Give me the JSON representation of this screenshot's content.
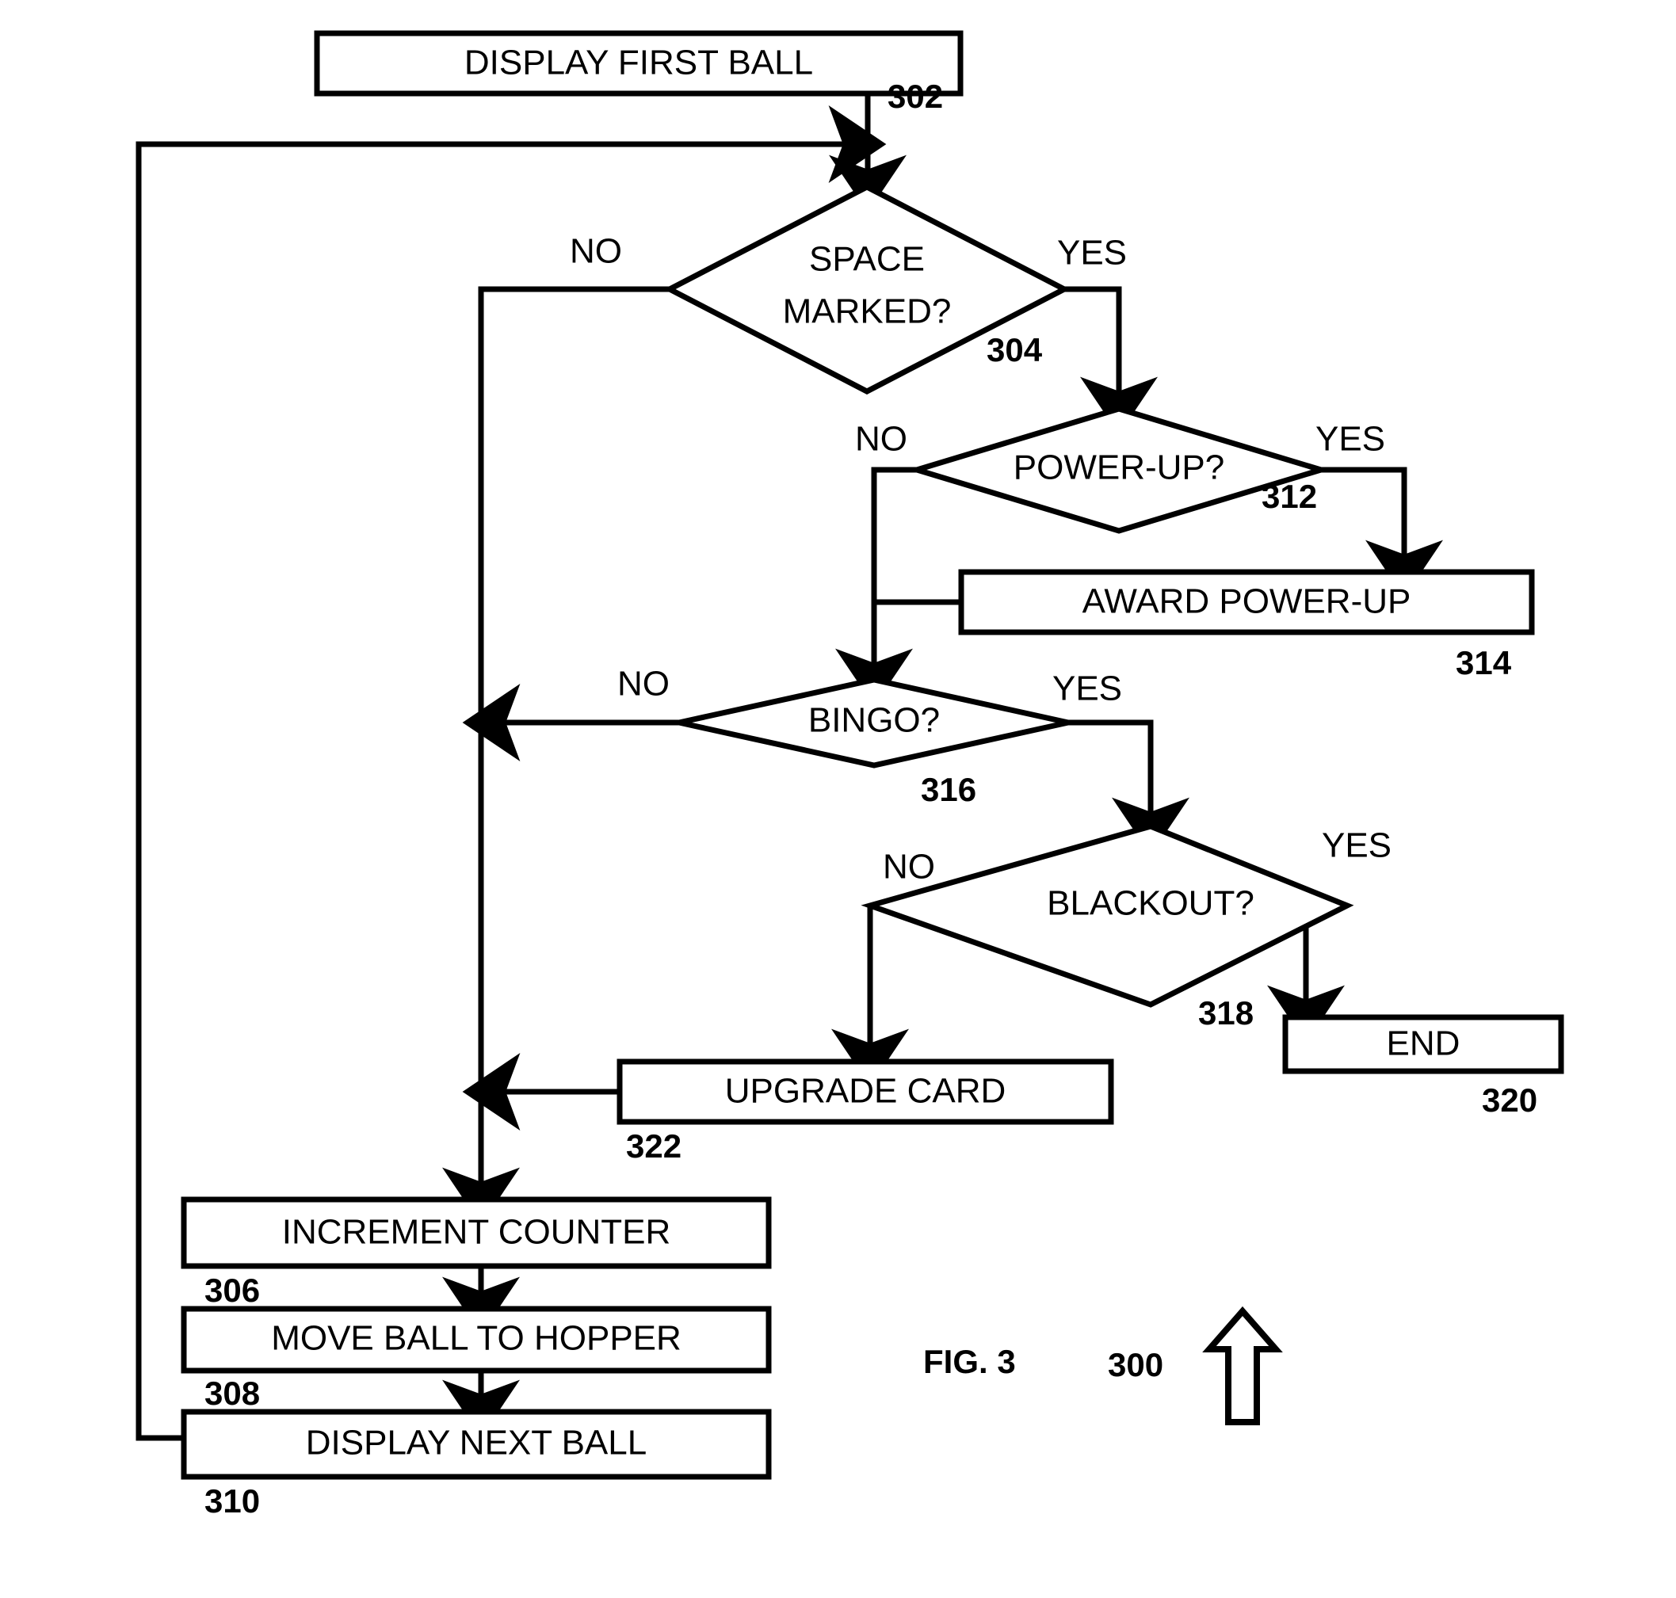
{
  "figure": {
    "caption": "FIG. 3",
    "figure_ref": "300",
    "orientation_icon": "up-arrow-icon"
  },
  "nodes": {
    "display_first_ball": {
      "label": "DISPLAY FIRST BALL",
      "ref": "302",
      "shape": "process"
    },
    "space_marked": {
      "label_line1": "SPACE",
      "label_line2": "MARKED?",
      "ref": "304",
      "shape": "decision"
    },
    "power_up": {
      "label": "POWER-UP?",
      "ref": "312",
      "shape": "decision"
    },
    "award_power_up": {
      "label": "AWARD POWER-UP",
      "ref": "314",
      "shape": "process"
    },
    "bingo": {
      "label": "BINGO?",
      "ref": "316",
      "shape": "decision"
    },
    "blackout": {
      "label": "BLACKOUT?",
      "ref": "318",
      "shape": "decision"
    },
    "end": {
      "label": "END",
      "ref": "320",
      "shape": "process"
    },
    "upgrade_card": {
      "label": "UPGRADE CARD",
      "ref": "322",
      "shape": "process"
    },
    "increment_counter": {
      "label": "INCREMENT COUNTER",
      "ref": "306",
      "shape": "process"
    },
    "move_ball_to_hopper": {
      "label": "MOVE BALL TO HOPPER",
      "ref": "308",
      "shape": "process"
    },
    "display_next_ball": {
      "label": "DISPLAY NEXT BALL",
      "ref": "310",
      "shape": "process"
    }
  },
  "branches": {
    "space_marked_no": "NO",
    "space_marked_yes": "YES",
    "power_up_no": "NO",
    "power_up_yes": "YES",
    "bingo_no": "NO",
    "bingo_yes": "YES",
    "blackout_no": "NO",
    "blackout_yes": "YES"
  },
  "colors": {
    "stroke": "#000000",
    "fill": "#ffffff",
    "background": "#ffffff"
  }
}
